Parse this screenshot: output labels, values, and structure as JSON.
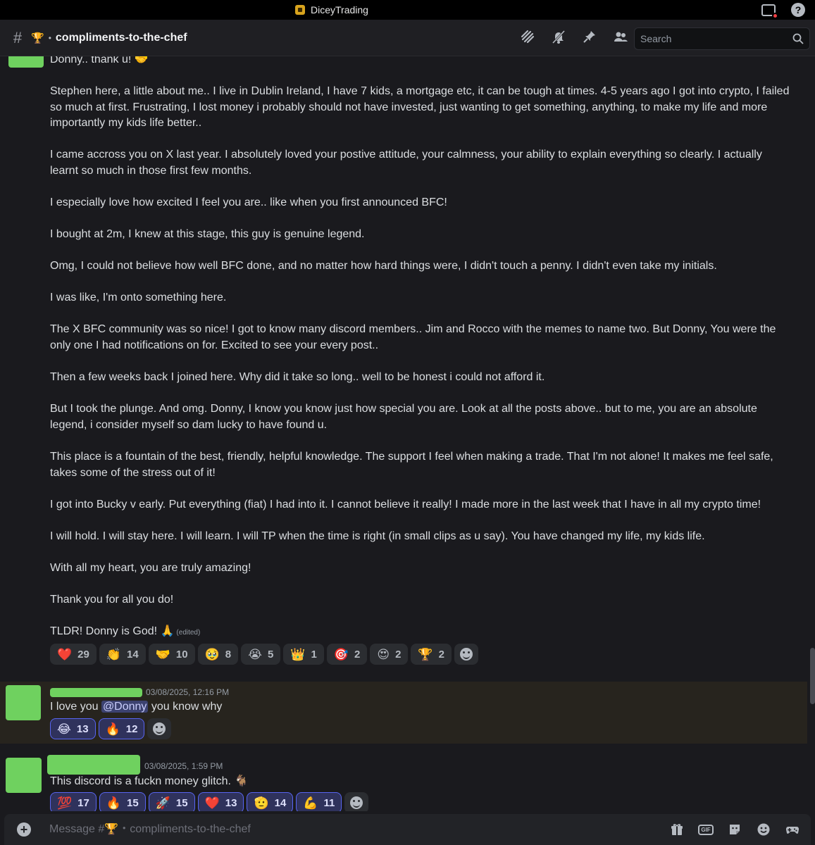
{
  "app": {
    "title": "DiceyTrading"
  },
  "channel": {
    "prefix_emoji": "🏆",
    "separator": "•",
    "name": "compliments-to-the-chef"
  },
  "search": {
    "placeholder": "Search"
  },
  "message1": {
    "paragraphs": [
      "Donny.. thank u! 🤝",
      "Stephen here, a little about me.. I live in Dublin Ireland, I have 7 kids, a mortgage etc, it can be tough at times. 4-5 years ago I got into crypto, I failed so much at first. Frustrating, I lost money i probably should not have invested, just wanting to get something, anything, to make my life and more importantly my kids life better..",
      "I came accross you on X last year. I absolutely loved your postive attitude, your calmness, your ability to explain everything so clearly. I actually learnt so much in those first few months.",
      "I especially love how excited I feel you are.. like when you first announced BFC!",
      "I bought at 2m, I knew at this stage, this guy is genuine legend.",
      "Omg, I could not believe how well BFC done, and no matter how hard things were, I didn't touch a penny. I didn't even take my initials.",
      "I was like, I'm onto something here.",
      "The X BFC community was so nice! I got to know many discord members.. Jim and Rocco with the memes to name two. But Donny, You were the only one I had notifications on for. Excited to see your every post..",
      "Then a few weeks back I joined here. Why did it take so long.. well to be honest i could not afford it.",
      "But I took the plunge. And omg. Donny, I know you know just how special you are. Look at all the posts above.. but to me, you are an absolute legend, i consider myself so dam lucky to have found u.",
      "This place is a fountain of the best, friendly, helpful knowledge. The support I feel when making a trade. That I'm not alone! It makes me feel safe, takes some of the stress out of it!",
      "I got into Bucky v early. Put everything (fiat) I had into it. I cannot believe it really! I made more in the last week that I have in all my crypto time!",
      "I will hold. I will stay here. I will learn. I will TP when the time is right (in small clips as u say). You have changed my life, my kids life.",
      "With all my heart, you are truly amazing!",
      "Thank you for all you do!",
      "TLDR! Donny is God! 🙏"
    ],
    "edited_label": "(edited)",
    "reactions": [
      {
        "emoji": "❤️",
        "count": "29"
      },
      {
        "emoji": "👏",
        "count": "14"
      },
      {
        "emoji": "🤝",
        "count": "10"
      },
      {
        "emoji": "🥹",
        "count": "8"
      },
      {
        "emoji": "😭",
        "count": "5"
      },
      {
        "emoji": "👑",
        "count": "1"
      },
      {
        "emoji": "🎯",
        "count": "2"
      },
      {
        "emoji": "😍",
        "count": "2"
      },
      {
        "emoji": "🏆",
        "count": "2"
      }
    ]
  },
  "message2": {
    "timestamp": "03/08/2025, 12:16 PM",
    "text_before": "I love you ",
    "mention": "@Donny",
    "text_after": " you know why",
    "reactions": [
      {
        "emoji": "😂",
        "count": "13"
      },
      {
        "emoji": "🔥",
        "count": "12"
      }
    ]
  },
  "message3": {
    "timestamp": "03/08/2025, 1:59 PM",
    "text": "This discord is a fuckn money glitch. 🐐",
    "reactions": [
      {
        "emoji": "💯",
        "count": "17"
      },
      {
        "emoji": "🔥",
        "count": "15"
      },
      {
        "emoji": "🚀",
        "count": "15"
      },
      {
        "emoji": "❤️",
        "count": "13"
      },
      {
        "emoji": "🫡",
        "count": "14"
      },
      {
        "emoji": "💪",
        "count": "11"
      }
    ]
  },
  "composer": {
    "placeholder": "Message #🏆・compliments-to-the-chef"
  },
  "icons": {
    "header": [
      "threads-icon",
      "mute-bell-icon",
      "pin-icon",
      "members-icon"
    ],
    "composer": [
      "gift-icon",
      "gif-icon",
      "sticker-icon",
      "emoji-icon",
      "apps-icon"
    ]
  },
  "colors": {
    "background": "#1a1a1e",
    "highlight": "#27241e",
    "mention": "#3c4270",
    "accent": "#5865f2",
    "redacted": "#6fd15f"
  }
}
